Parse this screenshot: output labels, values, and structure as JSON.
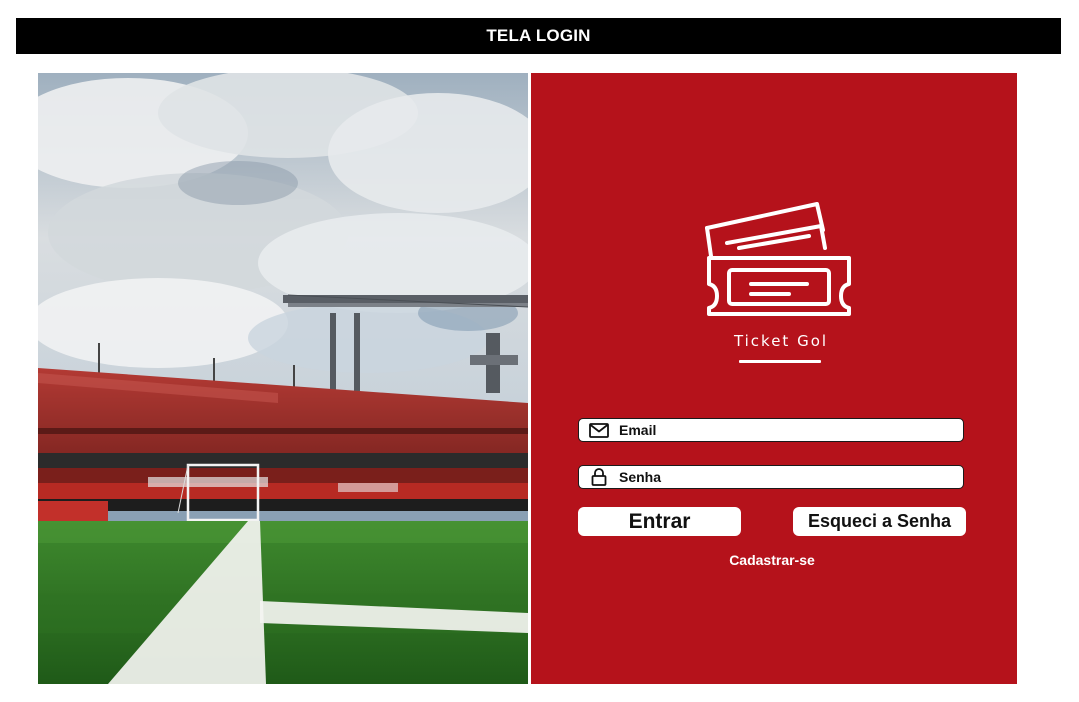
{
  "header": {
    "title": "TELA LOGIN"
  },
  "photo": {
    "description_icon": "stadium-photo"
  },
  "brand": {
    "name": "Ticket Gol",
    "logo_icon": "tickets-icon"
  },
  "form": {
    "email_label": "Email",
    "email_icon": "envelope-icon",
    "password_label": "Senha",
    "password_icon": "lock-icon",
    "enter_label": "Entrar",
    "forgot_label": "Esqueci a Senha",
    "signup_label": "Cadastrar-se"
  },
  "colors": {
    "panel": "#b5121b",
    "header_bg": "#000000"
  }
}
